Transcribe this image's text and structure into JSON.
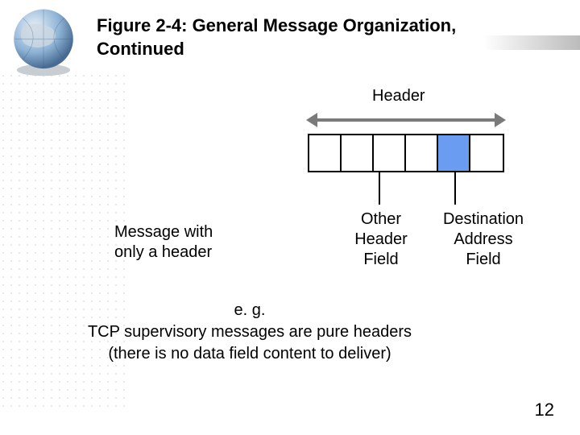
{
  "title": "Figure 2-4: General Message Organization, Continued",
  "header_label": "Header",
  "message_with": "Message with\nonly a header",
  "other_field": "Other\nHeader\nField",
  "dest_field": "Destination\nAddress\nField",
  "example": "e. g.\nTCP supervisory messages are pure headers\n(there is no data field content to deliver)",
  "page_number": "12"
}
